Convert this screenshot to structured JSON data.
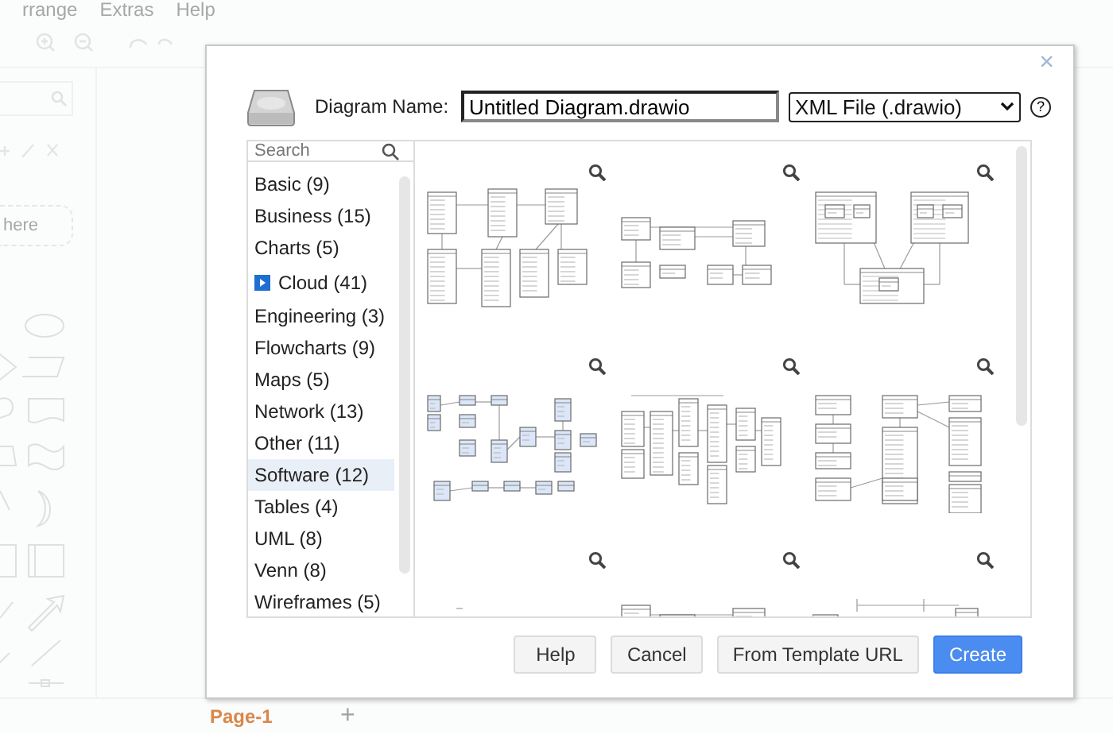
{
  "background": {
    "menu": [
      "rrange",
      "Extras",
      "Help"
    ],
    "scratchpad_hint": "here",
    "page_tab": "Page-1",
    "add_page": "+"
  },
  "dialog": {
    "close": "×",
    "name_label": "Diagram Name:",
    "name_value": "Untitled Diagram.drawio",
    "format": "XML File (.drawio)",
    "help_mark": "?",
    "search": {
      "placeholder": "Search"
    },
    "categories": [
      {
        "label": "Basic (9)",
        "selected": false,
        "has_icon": false
      },
      {
        "label": "Business (15)",
        "selected": false,
        "has_icon": false
      },
      {
        "label": "Charts (5)",
        "selected": false,
        "has_icon": false
      },
      {
        "label": "Cloud (41)",
        "selected": false,
        "has_icon": true
      },
      {
        "label": "Engineering (3)",
        "selected": false,
        "has_icon": false
      },
      {
        "label": "Flowcharts (9)",
        "selected": false,
        "has_icon": false
      },
      {
        "label": "Maps (5)",
        "selected": false,
        "has_icon": false
      },
      {
        "label": "Network (13)",
        "selected": false,
        "has_icon": false
      },
      {
        "label": "Other (11)",
        "selected": false,
        "has_icon": false
      },
      {
        "label": "Software (12)",
        "selected": true,
        "has_icon": false
      },
      {
        "label": "Tables (4)",
        "selected": false,
        "has_icon": false
      },
      {
        "label": "UML (8)",
        "selected": false,
        "has_icon": false
      },
      {
        "label": "Venn (8)",
        "selected": false,
        "has_icon": false
      },
      {
        "label": "Wireframes (5)",
        "selected": false,
        "has_icon": false
      }
    ],
    "templates": [
      {
        "kind": "class"
      },
      {
        "kind": "class-small"
      },
      {
        "kind": "component"
      },
      {
        "kind": "er-blue"
      },
      {
        "kind": "table-er"
      },
      {
        "kind": "table-er-2"
      },
      {
        "kind": "sparse"
      },
      {
        "kind": "class-small"
      },
      {
        "kind": "timeline"
      }
    ],
    "buttons": [
      {
        "label": "Help",
        "kind": "plain"
      },
      {
        "label": "Cancel",
        "kind": "plain"
      },
      {
        "label": "From Template URL",
        "kind": "plain"
      },
      {
        "label": "Create",
        "kind": "primary"
      }
    ]
  }
}
